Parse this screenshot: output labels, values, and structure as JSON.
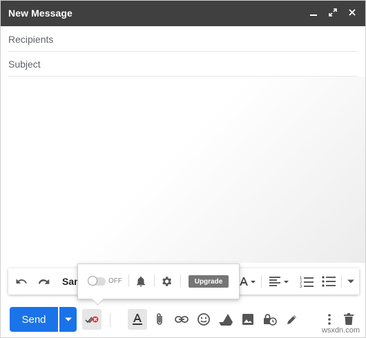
{
  "window": {
    "title": "New Message"
  },
  "fields": {
    "recipients_placeholder": "Recipients",
    "subject_placeholder": "Subject"
  },
  "formatting": {
    "font": "San"
  },
  "tracker_popup": {
    "toggle_state": "OFF",
    "upgrade_label": "Upgrade"
  },
  "bottom_bar": {
    "send_label": "Send"
  },
  "watermark": "wsxdn.com",
  "colors": {
    "titlebar": "#404040",
    "send_blue": "#1a73e8",
    "tracker_red": "#e53935"
  }
}
